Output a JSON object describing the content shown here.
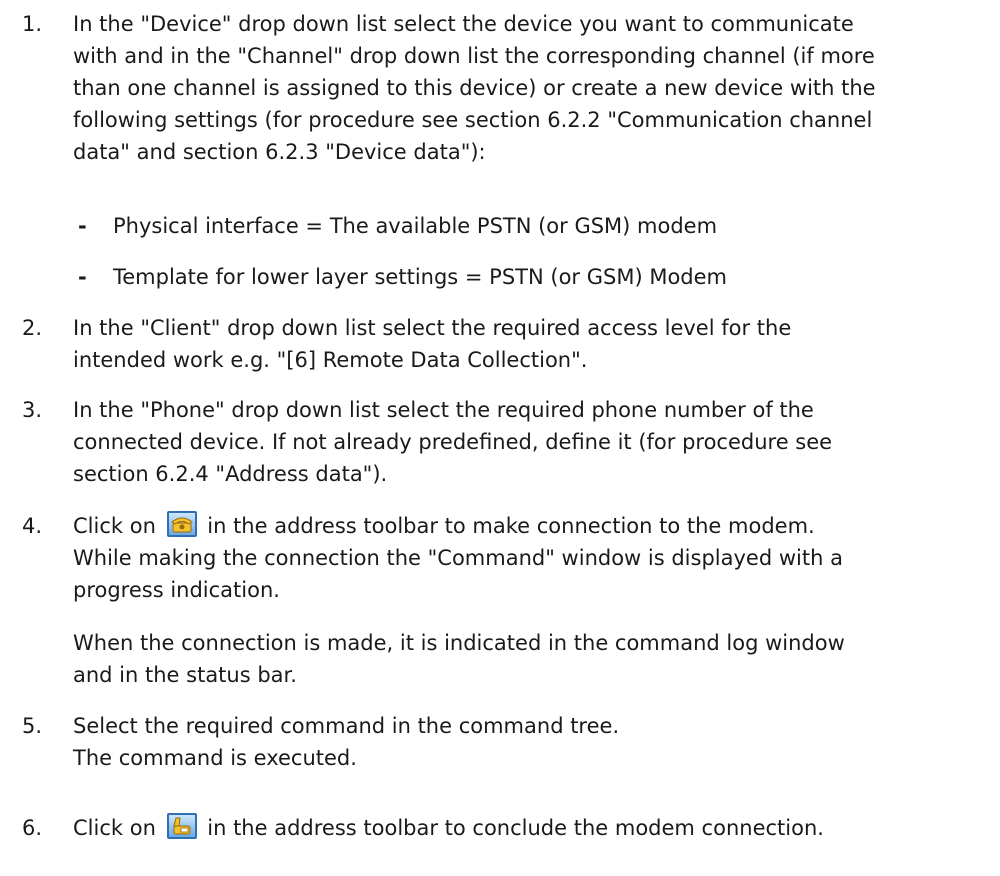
{
  "steps": [
    {
      "number": "1.",
      "lines": [
        "In the \"Device\" drop down list select the device you want to communicate",
        "with and in the \"Channel\" drop down list the corresponding channel (if more",
        "than one channel is assigned to this device) or create a new device with the",
        "following settings (for procedure see section 6.2.2 \"Communication channel",
        "data\" and section 6.2.3 \"Device data\"):"
      ],
      "subitems": [
        {
          "bullet": "-",
          "text": "Physical interface = The available PSTN (or GSM) modem"
        },
        {
          "bullet": "-",
          "text": "Template for lower layer settings = PSTN (or GSM) Modem"
        }
      ]
    },
    {
      "number": "2.",
      "lines": [
        "In the \"Client\" drop down list select the required access level for the",
        "intended work e.g. \"[6] Remote Data Collection\"."
      ]
    },
    {
      "number": "3.",
      "lines": [
        "In the \"Phone\" drop down list select the required phone number of the",
        "connected device. If not already predefined, define it (for procedure see",
        "section 6.2.4 \"Address data\")."
      ]
    },
    {
      "number": "4.",
      "line1_before": "Click on",
      "line1_after": "in the address toolbar to make connection to the modem.",
      "lines": [
        "While making the connection the \"Command\" window is displayed with a",
        "progress indication."
      ],
      "note_lines": [
        "When the connection is made, it is indicated in the command log window",
        "and in the status bar."
      ],
      "icon": "phone-connect-icon"
    },
    {
      "number": "5.",
      "lines": [
        "Select the required command in the command tree.",
        "The command is executed."
      ]
    },
    {
      "number": "6.",
      "line1_before": "Click on",
      "line1_after": "in the address toolbar to conclude the modem connection.",
      "icon": "phone-disconnect-icon"
    }
  ]
}
